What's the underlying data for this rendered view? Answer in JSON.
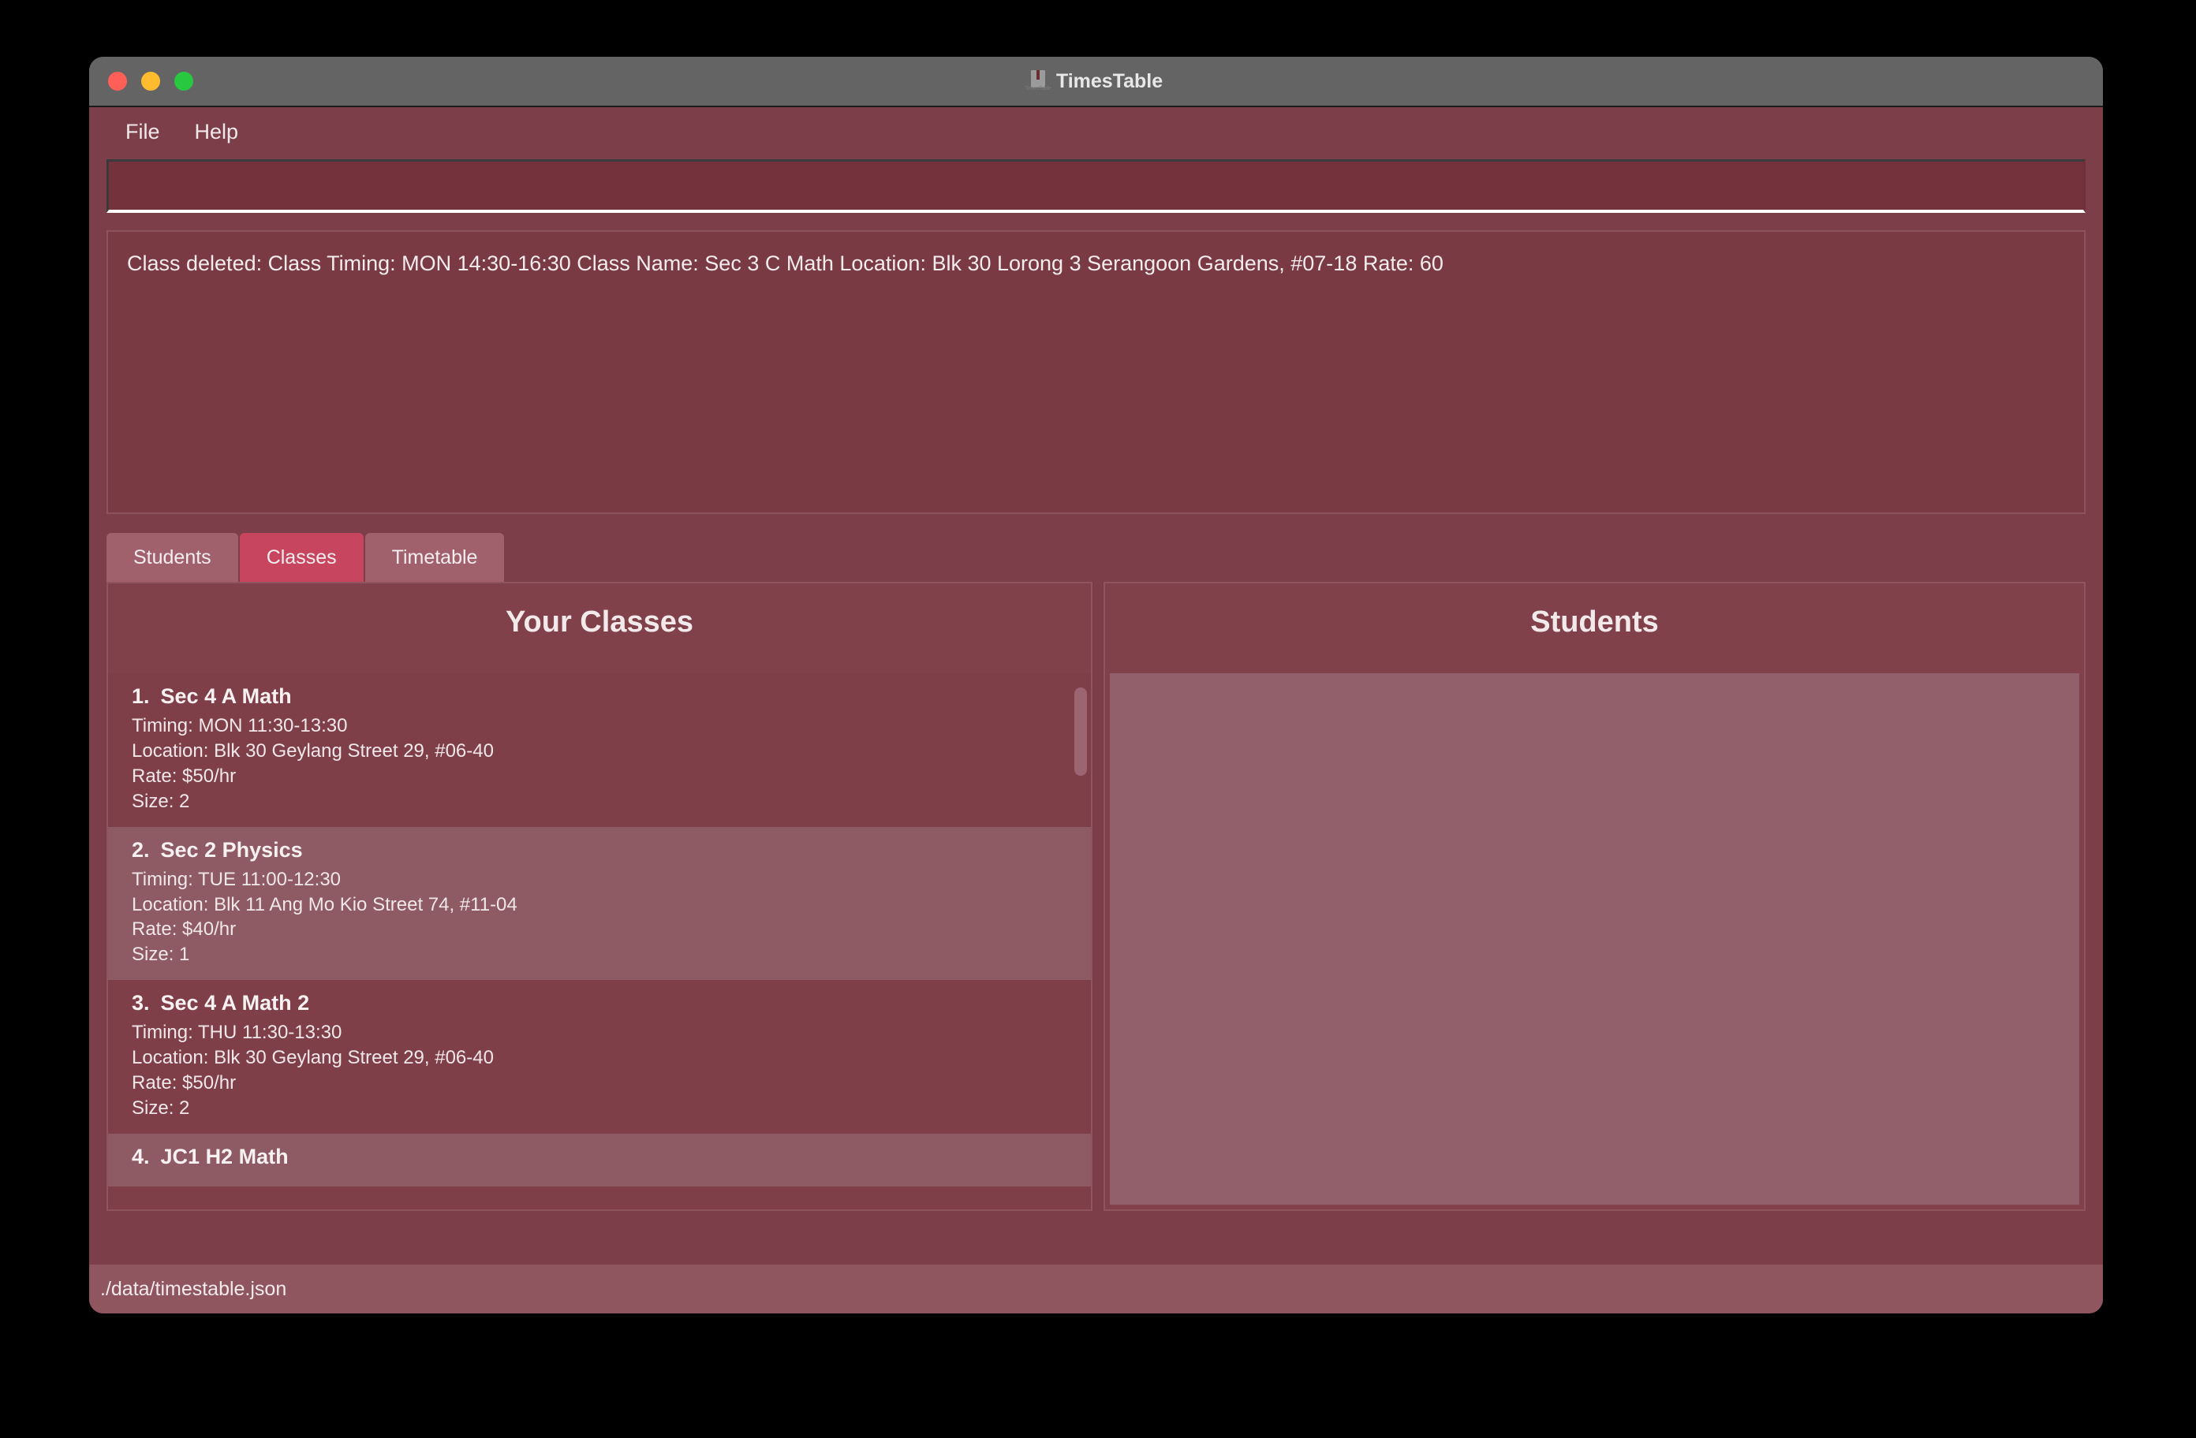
{
  "window": {
    "title": "TimesTable",
    "icon_name": "book-icon",
    "icon_caption": "TimesTable",
    "traffic_lights": [
      {
        "name": "close",
        "color": "#ff5f57"
      },
      {
        "name": "minimize",
        "color": "#febc2e"
      },
      {
        "name": "maximize",
        "color": "#28c840"
      }
    ]
  },
  "menubar": {
    "items": [
      {
        "label": "File"
      },
      {
        "label": "Help"
      }
    ]
  },
  "command": {
    "value": "",
    "placeholder": ""
  },
  "result": {
    "message": "Class deleted: Class Timing: MON 14:30-16:30  Class Name: Sec 3 C Math Location: Blk 30 Lorong 3 Serangoon Gardens, #07-18 Rate: 60"
  },
  "tabs": [
    {
      "label": "Students",
      "active": false
    },
    {
      "label": "Classes",
      "active": true
    },
    {
      "label": "Timetable",
      "active": false
    }
  ],
  "panels": {
    "classes": {
      "title": "Your Classes",
      "items": [
        {
          "index": "1.",
          "name": "Sec 4 A Math",
          "timing": "Timing: MON 11:30-13:30",
          "location": "Location: Blk 30 Geylang Street 29, #06-40",
          "rate": "Rate: $50/hr",
          "size": "Size: 2",
          "highlighted": false
        },
        {
          "index": "2.",
          "name": "Sec 2 Physics",
          "timing": "Timing: TUE 11:00-12:30",
          "location": "Location: Blk 11 Ang Mo Kio Street 74, #11-04",
          "rate": "Rate: $40/hr",
          "size": "Size: 1",
          "highlighted": true
        },
        {
          "index": "3.",
          "name": "Sec 4 A Math 2",
          "timing": "Timing: THU 11:30-13:30",
          "location": "Location: Blk 30 Geylang Street 29, #06-40",
          "rate": "Rate: $50/hr",
          "size": "Size: 2",
          "highlighted": false
        },
        {
          "index": "4.",
          "name": "JC1 H2 Math",
          "timing": "",
          "location": "",
          "rate": "",
          "size": "",
          "highlighted": true
        }
      ]
    },
    "students": {
      "title": "Students",
      "items": []
    }
  },
  "statusbar": {
    "path": "./data/timestable.json"
  },
  "colors": {
    "window_bg": "#7c3e48",
    "titlebar_bg": "#646464",
    "panel_bg": "#81414b",
    "tab_active": "#c8455f",
    "tab_inactive": "#a1616c",
    "highlight_row": "#8e5a64",
    "statusbar_bg": "#90565f"
  }
}
